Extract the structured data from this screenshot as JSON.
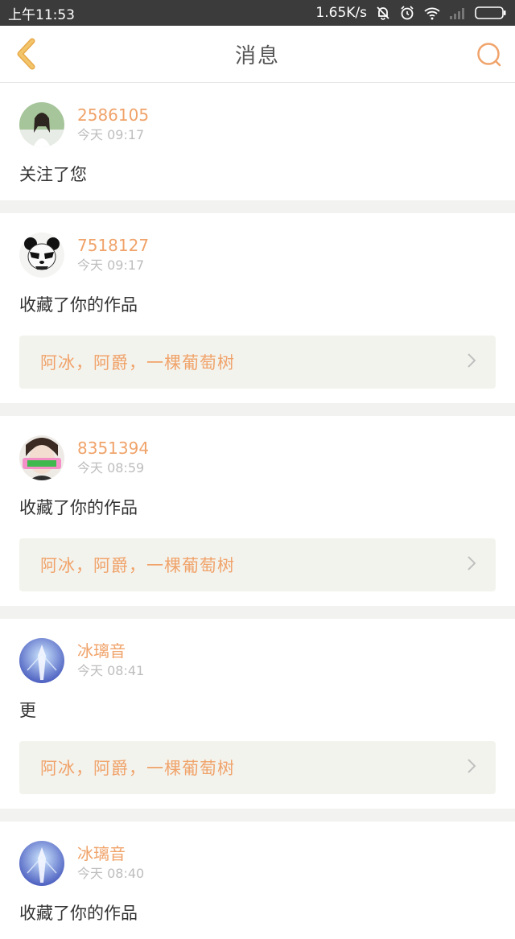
{
  "status_bar": {
    "time": "上午11:53",
    "speed": "1.65K/s",
    "icons": [
      "mute-bell-icon",
      "alarm-icon",
      "wifi-icon",
      "signal-icon",
      "battery-icon"
    ]
  },
  "header": {
    "title": "消息",
    "back_icon": "chevron-left-icon",
    "search_icon": "search-icon"
  },
  "accent_color": "#f0a36a",
  "messages": [
    {
      "user": "2586105",
      "time": "今天 09:17",
      "action": "关注了您",
      "work": null
    },
    {
      "user": "7518127",
      "time": "今天 09:17",
      "action": "收藏了你的作品",
      "work": "阿冰，阿爵，一棵葡萄树"
    },
    {
      "user": "8351394",
      "time": "今天 08:59",
      "action": "收藏了你的作品",
      "work": "阿冰，阿爵，一棵葡萄树"
    },
    {
      "user": "冰璃音",
      "time": "今天 08:41",
      "action": "更",
      "work": "阿冰，阿爵，一棵葡萄树"
    },
    {
      "user": "冰璃音",
      "time": "今天 08:40",
      "action": "收藏了你的作品",
      "work": null
    }
  ]
}
